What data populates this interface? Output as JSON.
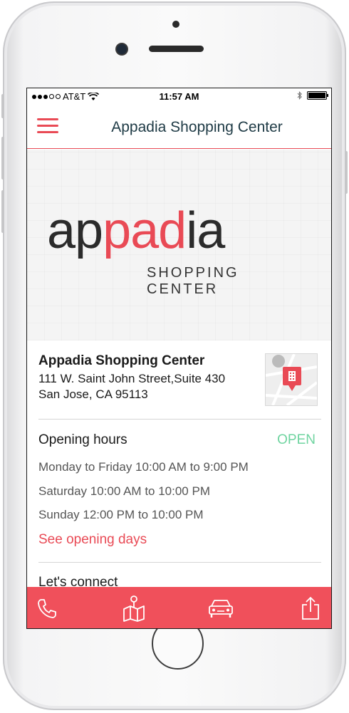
{
  "status_bar": {
    "carrier": "AT&T",
    "time": "11:57 AM"
  },
  "navbar": {
    "title": "Appadia Shopping Center"
  },
  "hero": {
    "logo_part1": "ap",
    "logo_part2": "pad",
    "logo_part3": "ia",
    "logo_subtitle": "SHOPPING CENTER"
  },
  "info": {
    "name": "Appadia Shopping Center",
    "address_line1": "111 W. Saint John Street,Suite 430",
    "address_line2": "San Jose, CA 95113"
  },
  "hours": {
    "title": "Opening hours",
    "status": "OPEN",
    "lines": [
      "Monday to Friday 10:00 AM to 9:00 PM",
      "Saturday 10:00 AM to 10:00 PM",
      "Sunday 12:00 PM to 10:00 PM"
    ],
    "see_days": "See opening days"
  },
  "connect": {
    "title": "Let's connect"
  },
  "tabbar": {
    "icons": [
      "phone-icon",
      "map-icon",
      "car-icon",
      "share-icon"
    ]
  },
  "colors": {
    "accent": "#e94a55",
    "open": "#6fd4a0",
    "tabbar": "#f0505b",
    "title": "#1e3a45"
  }
}
